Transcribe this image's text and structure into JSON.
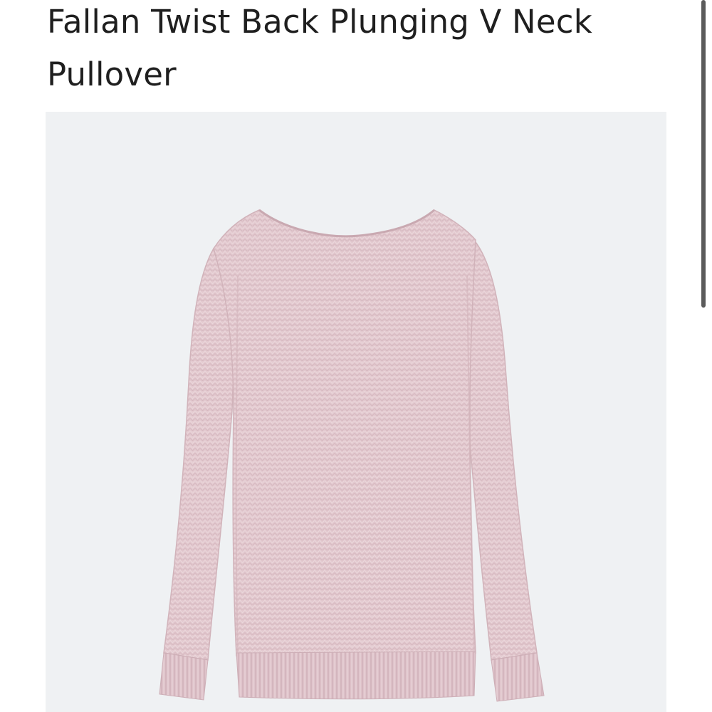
{
  "product": {
    "title": "Fallan Twist Back Plunging V Neck Pullover",
    "image": {
      "subject": "pink-knit-sweater",
      "background_color": "#eff1f3",
      "garment_color": "#e3c9cf"
    }
  },
  "scrollbar": {
    "position": 0,
    "visible_fraction": 0.43
  }
}
